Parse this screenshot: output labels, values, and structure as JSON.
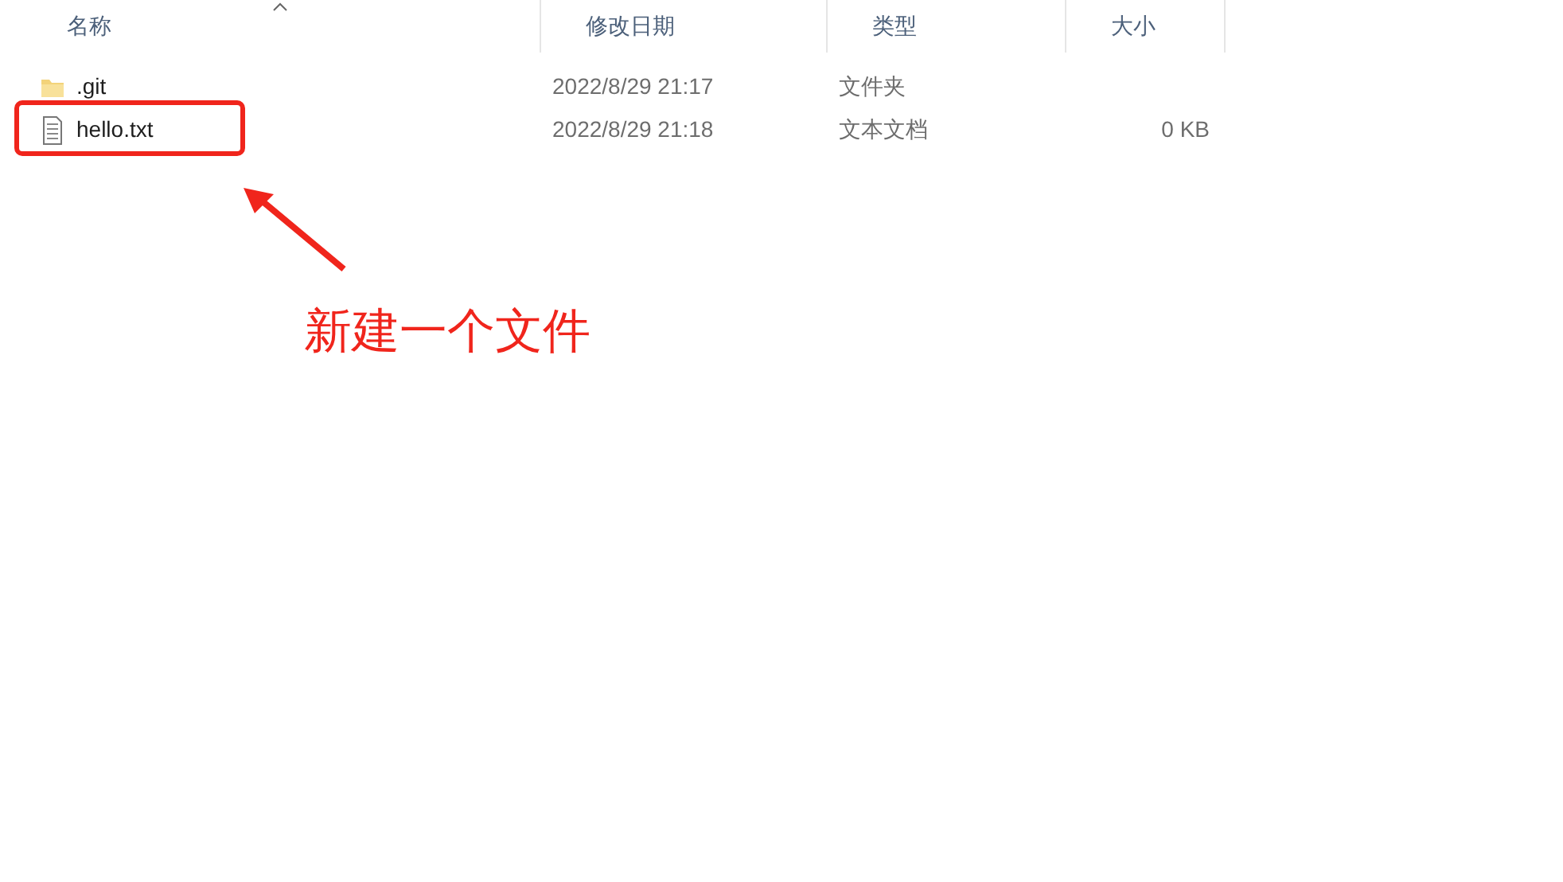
{
  "columns": [
    {
      "label": "名称",
      "sorted": true
    },
    {
      "label": "修改日期",
      "sorted": false
    },
    {
      "label": "类型",
      "sorted": false
    },
    {
      "label": "大小",
      "sorted": false
    }
  ],
  "rows": [
    {
      "kind": "folder",
      "name": ".git",
      "modified": "2022/8/29 21:17",
      "type": "文件夹"
    },
    {
      "kind": "text",
      "name": "hello.txt",
      "modified": "2022/8/29 21:18",
      "type": "文本文档",
      "size": "0 KB"
    }
  ],
  "annotation": {
    "text": "新建一个文件"
  }
}
